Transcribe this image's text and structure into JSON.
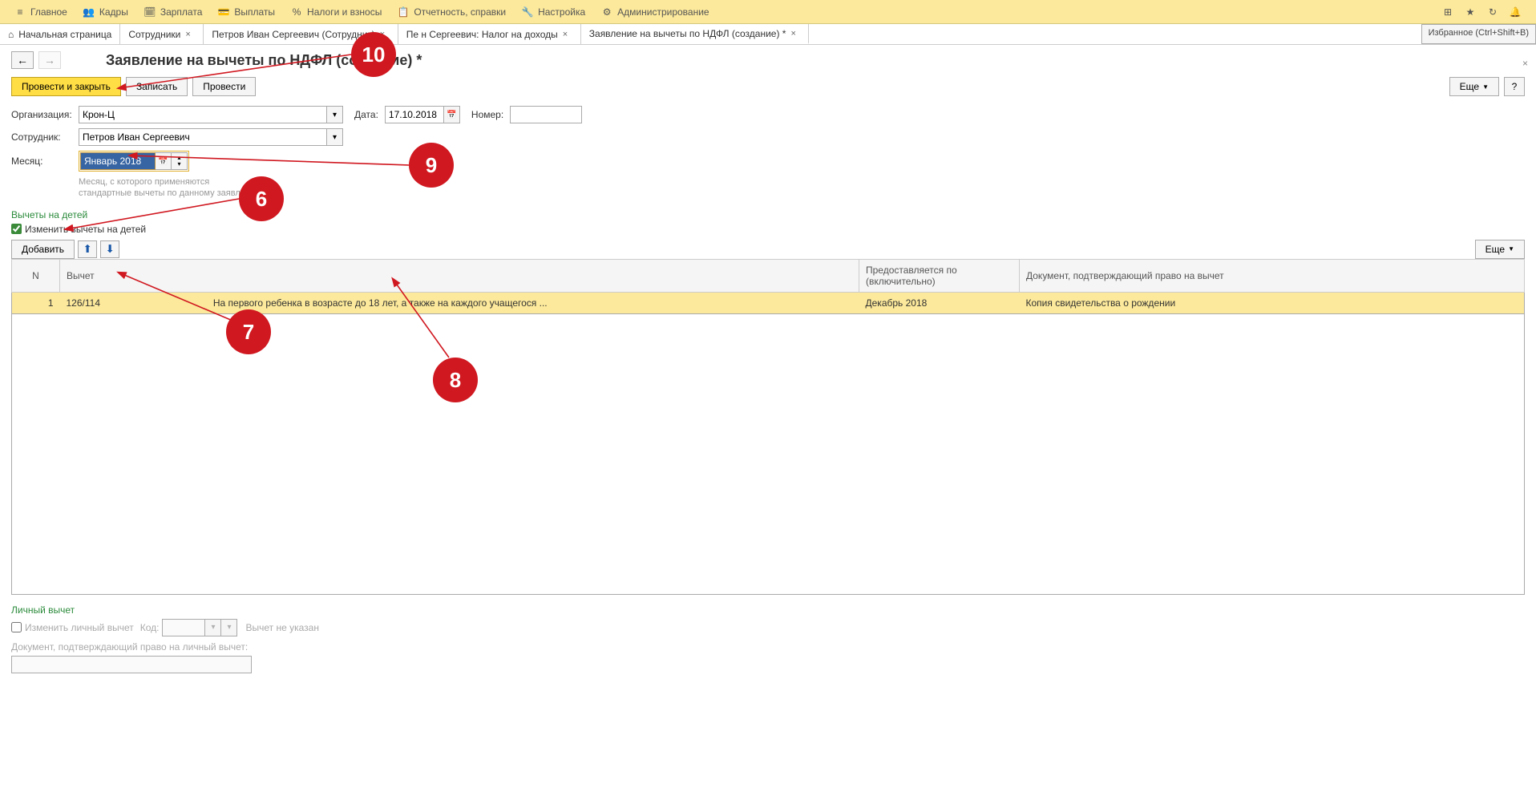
{
  "menubar": {
    "items": [
      {
        "icon": "≡",
        "label": "Главное"
      },
      {
        "icon": "👥",
        "label": "Кадры"
      },
      {
        "icon": "🗓",
        "label": "Зарплата"
      },
      {
        "icon": "💳",
        "label": "Выплаты"
      },
      {
        "icon": "%",
        "label": "Налоги и взносы"
      },
      {
        "icon": "📋",
        "label": "Отчетность, справки"
      },
      {
        "icon": "🔧",
        "label": "Настройка"
      },
      {
        "icon": "⚙",
        "label": "Администрирование"
      }
    ]
  },
  "tabs": [
    {
      "label": "Начальная страница",
      "icon": "home",
      "closable": false
    },
    {
      "label": "Сотрудники",
      "closable": true
    },
    {
      "label": "Петров Иван Сергеевич (Сотрудник)",
      "closable": true
    },
    {
      "label": "Пе         н Сергеевич: Налог на доходы",
      "closable": true
    },
    {
      "label": "Заявление на вычеты по НДФЛ (создание) *",
      "closable": true,
      "active": true
    }
  ],
  "favorites_hint": "Избранное (Ctrl+Shift+B)",
  "page": {
    "title": "Заявление на вычеты по НДФЛ (создание) *"
  },
  "toolbar": {
    "post_close": "Провести и закрыть",
    "save": "Записать",
    "post": "Провести",
    "more": "Еще",
    "help": "?"
  },
  "form": {
    "org_label": "Организация:",
    "org_value": "Крон-Ц",
    "date_label": "Дата:",
    "date_value": "17.10.2018",
    "num_label": "Номер:",
    "num_value": "",
    "emp_label": "Сотрудник:",
    "emp_value": "Петров Иван Сергеевич",
    "month_label": "Месяц:",
    "month_value": "Январь 2018",
    "month_hint1": "Месяц, с которого применяются",
    "month_hint2": "стандартные вычеты по данному заявлению"
  },
  "children": {
    "section_title": "Вычеты на детей",
    "checkbox_label": "Изменить вычеты на детей",
    "add_btn": "Добавить",
    "more_btn": "Еще",
    "columns": {
      "n": "N",
      "deduction": "Вычет",
      "until": "Предоставляется по (включительно)",
      "doc": "Документ, подтверждающий право на вычет"
    },
    "rows": [
      {
        "n": "1",
        "code": "126/114",
        "desc": "На первого ребенка в возрасте до 18 лет, а также на каждого учащегося ...",
        "until": "Декабрь 2018",
        "doc": "Копия свидетельства о рождении"
      }
    ]
  },
  "personal": {
    "section_title": "Личный вычет",
    "checkbox_label": "Изменить личный вычет",
    "code_label": "Код:",
    "not_set": "Вычет не указан",
    "doc_label": "Документ, подтверждающий право на личный вычет:"
  },
  "markers": {
    "m6": "6",
    "m7": "7",
    "m8": "8",
    "m9": "9",
    "m10": "10"
  }
}
